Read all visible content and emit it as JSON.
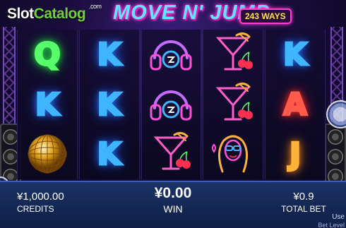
{
  "branding": {
    "site_logo_part1": "Slot",
    "site_logo_part2": "Catalog",
    "site_logo_suffix": ".com",
    "game_title": "MOVE N' JUMP",
    "ways_badge": "243 WAYS"
  },
  "reels": [
    [
      "Q",
      "K",
      "disco-ball"
    ],
    [
      "K",
      "K",
      "K"
    ],
    [
      "headphones",
      "headphones",
      "cocktail"
    ],
    [
      "cocktail",
      "cocktail",
      "neon-woman"
    ],
    [
      "K",
      "A",
      "J"
    ]
  ],
  "stats": {
    "credits_value": "¥1,000.00",
    "credits_label": "CREDITS",
    "win_value": "¥0.00",
    "win_label": "WIN",
    "total_bet_value": "¥0.9",
    "total_bet_label": "TOTAL BET"
  },
  "footer": {
    "use_text": "Use",
    "bet_level_text": "Bet Level"
  },
  "colors": {
    "Q": "#57ff6a",
    "K": "#3fb6ff",
    "A": "#ff5a4a",
    "J": "#ffb23a",
    "bottom_bar": "#1a3266",
    "title_cyan": "#5ee7ff",
    "title_pink": "#ff2fd6"
  }
}
